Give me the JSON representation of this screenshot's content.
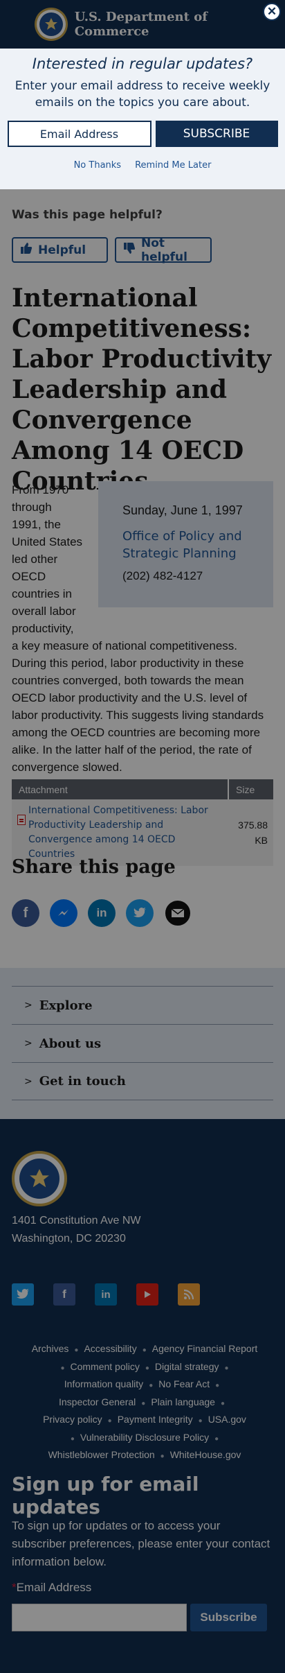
{
  "header": {
    "title": "U.S. Department of Commerce",
    "close_glyph": "✕"
  },
  "modal": {
    "title": "Interested in regular updates?",
    "description": "Enter your email address to receive weekly emails on the topics you care about.",
    "email_placeholder": "Email Address",
    "subscribe_label": "SUBSCRIBE",
    "no_thanks": "No Thanks",
    "remind_later": "Remind Me Later"
  },
  "feedback": {
    "question": "Was this page helpful?",
    "helpful_label": "Helpful",
    "not_helpful_label": "Not helpful"
  },
  "article": {
    "title": "International Competitiveness: Labor Productivity Leadership and Convergence Among 14 OECD Countries",
    "body_wrapped": [
      "From 1970",
      "through",
      "1991, the",
      "United States",
      "led other",
      "OECD",
      "countries in",
      "overall labor",
      "productivity,"
    ],
    "body_full": "a key measure of national competitiveness. During this period, labor productivity in these countries converged, both towards the mean OECD labor productivity and the U.S. level of labor productivity. This suggests living standards among the OECD countries are becoming more alike. In the latter half of the period, the rate of convergence slowed."
  },
  "infobox": {
    "date": "Sunday, June 1, 1997",
    "office": "Office of Policy and Strategic Planning",
    "phone": "(202) 482-4127"
  },
  "attachments": {
    "col_attachment": "Attachment",
    "col_size": "Size",
    "rows": [
      {
        "name": "International Competitiveness: Labor Productivity Leadership and Convergence among 14 OECD Countries",
        "size": "375.88 KB"
      }
    ]
  },
  "share": {
    "title": "Share this page",
    "icons": [
      "facebook-icon",
      "messenger-icon",
      "linkedin-icon",
      "twitter-icon",
      "email-icon"
    ]
  },
  "footer_nav": {
    "explore": "Explore",
    "about": "About us",
    "contact": "Get in touch"
  },
  "footer": {
    "address_line1": "1401 Constitution Ave NW",
    "address_line2": "Washington, DC 20230",
    "social": [
      "twitter-icon",
      "facebook-icon",
      "linkedin-icon",
      "youtube-icon",
      "rss-icon"
    ],
    "links": [
      "Archives",
      "Accessibility",
      "Agency Financial Report",
      "Comment policy",
      "Digital strategy",
      "Information quality",
      "No Fear Act",
      "Inspector General",
      "Plain language",
      "Privacy policy",
      "Payment Integrity",
      "USA.gov",
      "Vulnerability Disclosure Policy",
      "Whistleblower Protection",
      "WhiteHouse.gov"
    ]
  },
  "signup": {
    "title": "Sign up for email updates",
    "text": "To sign up for updates or to access your subscriber preferences, please enter your contact information below.",
    "required_mark": "*",
    "email_label": "Email Address",
    "button": "Subscribe"
  },
  "colors": {
    "navy": "#112e51",
    "link_blue": "#205493",
    "infobox_bg": "#dce4ef",
    "accordion_bg": "#e2e9f3"
  }
}
